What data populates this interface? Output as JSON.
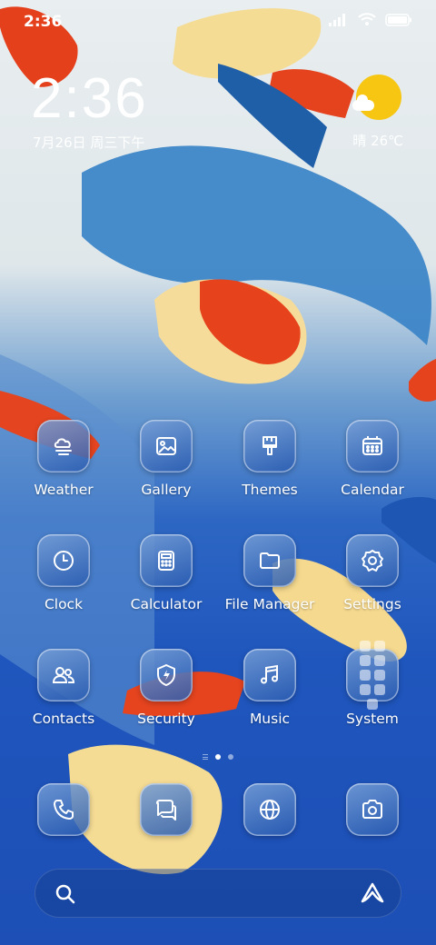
{
  "status_bar": {
    "time": "2:36"
  },
  "lock_clock": {
    "time": "2:36",
    "date": "7月26日 周三下午"
  },
  "weather": {
    "text": "晴 26℃",
    "sun_color": "#f6c612"
  },
  "apps": [
    {
      "label": "Weather",
      "icon": "weather-icon"
    },
    {
      "label": "Gallery",
      "icon": "gallery-icon"
    },
    {
      "label": "Themes",
      "icon": "themes-icon"
    },
    {
      "label": "Calendar",
      "icon": "calendar-icon"
    },
    {
      "label": "Clock",
      "icon": "clock-icon"
    },
    {
      "label": "Calculator",
      "icon": "calculator-icon"
    },
    {
      "label": "File Manager",
      "icon": "folder-icon"
    },
    {
      "label": "Settings",
      "icon": "gear-icon"
    },
    {
      "label": "Contacts",
      "icon": "contacts-icon"
    },
    {
      "label": "Security",
      "icon": "shield-icon"
    },
    {
      "label": "Music",
      "icon": "music-icon"
    },
    {
      "label": "System",
      "icon": "folder-grid-icon"
    }
  ],
  "page_indicator": {
    "pages": 2,
    "active": 1
  },
  "dock": [
    {
      "icon": "phone-icon"
    },
    {
      "icon": "messages-icon"
    },
    {
      "icon": "browser-icon"
    },
    {
      "icon": "camera-icon"
    }
  ],
  "search": {
    "icon": "search-icon",
    "assistant_icon": "assistant-icon"
  }
}
